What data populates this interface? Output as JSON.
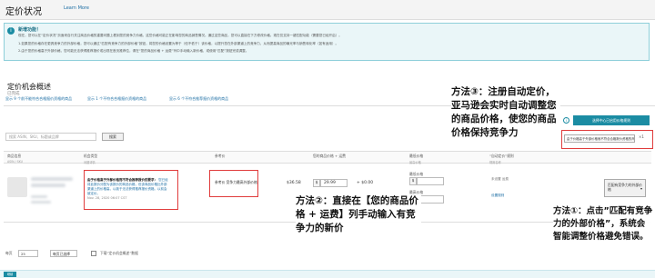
{
  "header": {
    "title": "定价状况",
    "learn_more": "Learn More"
  },
  "info": {
    "title": "新增功能！",
    "lines": [
      "现在，您可以在“定价状况”页面来自行关注商品价格的重要问题上看到您的竞争力价格，这些价格可能正在影响您的商品销售情况。通过这些商品，您可以直接在下方修改价格。现在仅支持一键匹配功能（需要您已经开启）。",
      "1.如果您的价格存在更具竞争力的外部价格，您可以通过“匹配有竞争力的外部价格”按钮，将您的价格设置为等于（但不低于）该价格，以提升您在外部渠道上的竞争力，从而提高商品的曝光率与销售转化率（如有适用）。",
      "2.由于您的价格高于外部价格，您可能无法获得推荐报价或出现在首页推荐位，请在“您的商品价格 + 运费”列中手动输入新价格，或使用“匹配”按钮完成调整。"
    ]
  },
  "overview": {
    "title": "定价机会概述",
    "subtitle": "已完成",
    "tabs": [
      "显示 9 个前不能符合合格报价资格的商品",
      "显示 1 个不符合合格报价资格的商品",
      "显示 6 个不符合推荐报价资格的商品"
    ]
  },
  "search": {
    "placeholder": "搜索 ASIN、SKU、标题或品牌",
    "button": "搜索"
  },
  "auto_pricing": {
    "button": "选择中心已启用价格规则",
    "select_value": "由于价格高于外部价格而不符合合格报价资格的商品 规则",
    "remove": "×1"
  },
  "table": {
    "headers": [
      {
        "label": "商品信息",
        "sub": "ASIN / SKU"
      },
      {
        "label": "机会类型",
        "sub": "问题详情"
      },
      {
        "label": "参考价",
        "sub": ""
      },
      {
        "label": "",
        "sub": ""
      },
      {
        "label": "您的商品价格 + 运费",
        "sub": ""
      },
      {
        "label": "最低价格",
        "sub": "最高价格"
      },
      {
        "label": "“自动定价”规则",
        "sub": "规则名称"
      },
      {
        "label": "",
        "sub": ""
      }
    ],
    "rows": [
      {
        "status_title": "由于价格高于外部价格而不符合推荐报价的要求：",
        "status_body": "您已经将此报价分配为该报价的商品价格，但该商品价格比外部渠道上的价格高，以致于无法获得推荐报价资格。以前会被定价。",
        "status_date": "Nov. 28, 2020 06:07 CST",
        "reference": "参考价 竞争力最高外部价格",
        "shipping": "$36.58",
        "your_price": "29.99",
        "shipping_add": "+ $0.00",
        "min_label": "最低价格",
        "max_label": "最高价格",
        "rule_label": "未设置 运费",
        "rule_link": "设置规则",
        "match_button": "匹配有竞争力的外部价格"
      }
    ]
  },
  "footer": {
    "label": "每页",
    "per_page": "25",
    "select_hint": "每页已选择",
    "download": "下载“定价机会概述”数据"
  },
  "bottom_button": "继续",
  "annotations": {
    "a3": "方法③：注册自动定价，亚马逊会实时自动调整您的商品价格，使您的商品价格保持竞争力",
    "a2": "方法②：直接在【您的商品价格 + 运费】列手动输入有竞争力的新价",
    "a1": "方法①：点击”匹配有竞争力的外部价格”，系统会智能调整价格避免错误。"
  },
  "colors": {
    "teal": "#1b8ca3",
    "highlight_red": "#e03c3c",
    "link": "#1c6ea4"
  }
}
